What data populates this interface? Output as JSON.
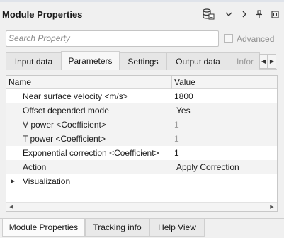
{
  "window": {
    "title": "Module Properties"
  },
  "header_icons": {
    "db_icon": "database-icon",
    "chevron_down": "⌄",
    "chevron_right": "›",
    "pin": "pin-icon",
    "expand": "restore-icon"
  },
  "search": {
    "placeholder": "Search Property"
  },
  "advanced": {
    "label": "Advanced",
    "checked": false
  },
  "tabs": [
    {
      "label": "Input data"
    },
    {
      "label": "Parameters",
      "active": true
    },
    {
      "label": "Settings"
    },
    {
      "label": "Output data"
    },
    {
      "label": "Infor"
    }
  ],
  "table": {
    "columns": {
      "name": "Name",
      "value": "Value"
    },
    "rows": [
      {
        "name": "Near surface velocity <m/s>",
        "value": "1800"
      },
      {
        "name": "Offset depended mode",
        "value": "Yes"
      },
      {
        "name": "V power <Coefficient>",
        "value": "1"
      },
      {
        "name": "T power <Coefficient>",
        "value": "1"
      },
      {
        "name": "Exponential correction <Coefficient>",
        "value": "1"
      },
      {
        "name": "Action",
        "value": "Apply Correction"
      },
      {
        "name": "Visualization",
        "value": ""
      }
    ]
  },
  "footer_tabs": [
    {
      "label": "Module Properties",
      "active": true
    },
    {
      "label": "Tracking info"
    },
    {
      "label": "Help View"
    }
  ]
}
